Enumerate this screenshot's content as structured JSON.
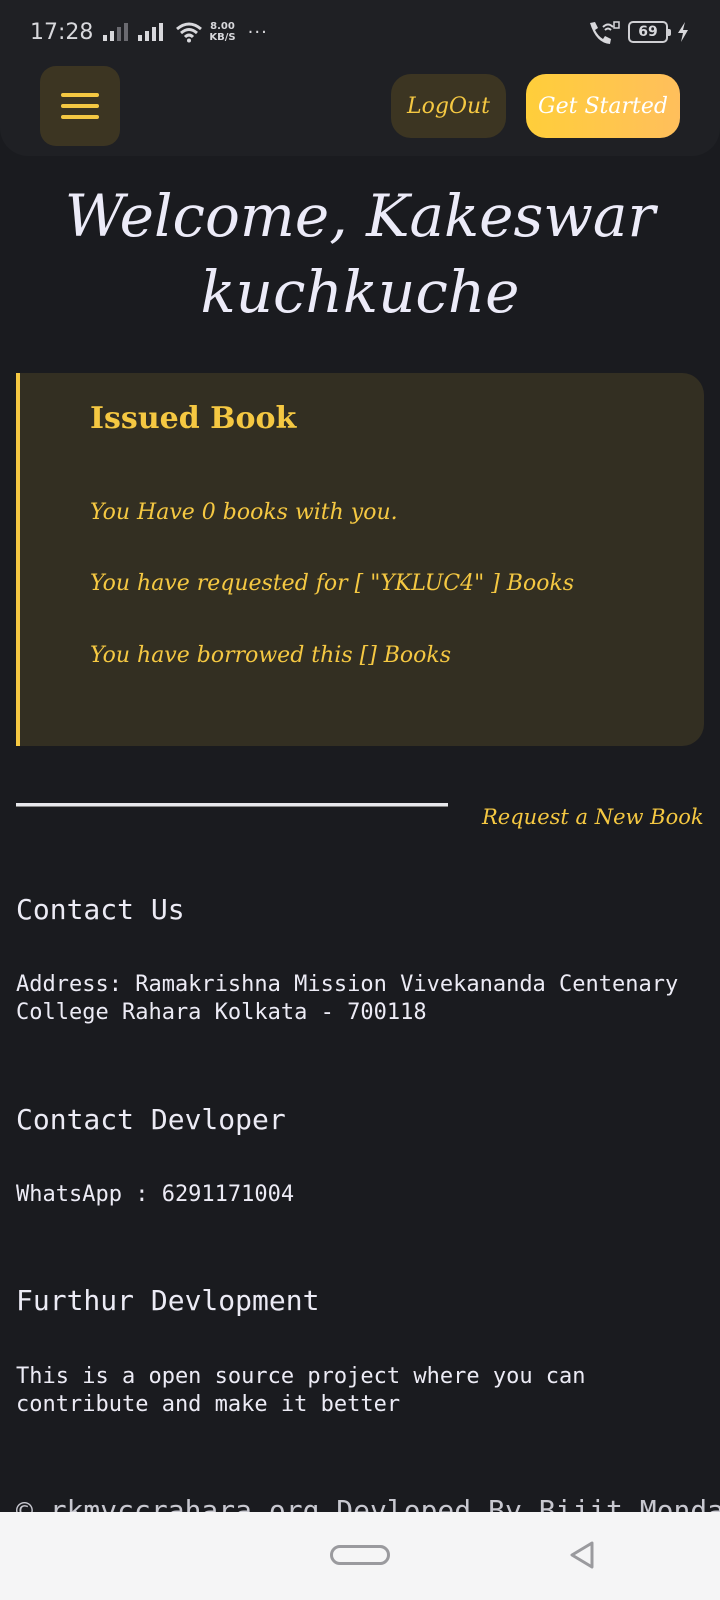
{
  "status_bar": {
    "time": "17:28",
    "net_speed_value": "8.00",
    "net_speed_unit": "KB/S",
    "more": "···",
    "battery": "69"
  },
  "navbar": {
    "logout_label": "LogOut",
    "get_started_label": "Get Started"
  },
  "welcome": {
    "line1": "Welcome, Kakeswar",
    "line2": "kuchkuche"
  },
  "issued": {
    "title": "Issued Book",
    "books_with_you": "You Have 0 books with you.",
    "requested": "You have requested for [ \"YKLUC4\" ] Books",
    "borrowed": "You have borrowed this [] Books"
  },
  "request_link": "Request a New Book",
  "contact_us": {
    "heading": "Contact Us",
    "address": "Address: Ramakrishna Mission Vivekananda Centenary College Rahara Kolkata - 700118"
  },
  "contact_developer": {
    "heading": "Contact Devloper",
    "whatsapp": "WhatsApp : 6291171004"
  },
  "further": {
    "heading": "Furthur Devlopment",
    "text": "This is a open source project where you can contribute and make it better"
  },
  "footer": "© rkmvccrahara.org Devloped By Bijit Mondal",
  "colors": {
    "background": "#1a1b1f",
    "accent": "#f5c842",
    "card": "#332f22"
  }
}
